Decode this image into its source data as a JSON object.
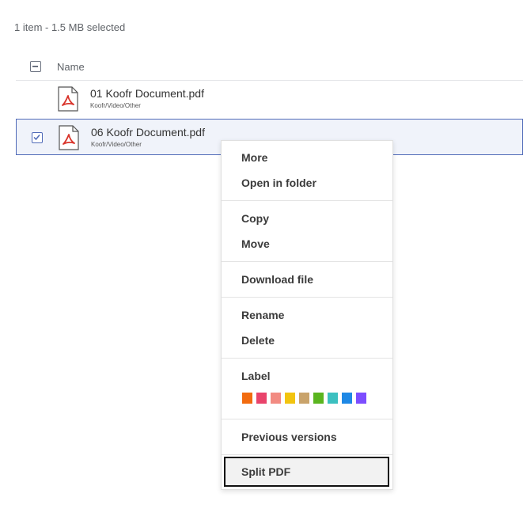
{
  "selection": {
    "summary": "1 item - 1.5 MB selected"
  },
  "list": {
    "header": {
      "name_label": "Name"
    },
    "files": [
      {
        "name": "01 Koofr Document.pdf",
        "path": "Koofr/Video/Other",
        "selected": false,
        "icon": "pdf-file-icon"
      },
      {
        "name": "06 Koofr Document.pdf",
        "path": "Koofr/Video/Other",
        "selected": true,
        "icon": "pdf-file-icon"
      }
    ]
  },
  "context_menu": {
    "more": "More",
    "open_in_folder": "Open in folder",
    "copy": "Copy",
    "move": "Move",
    "download_file": "Download file",
    "rename": "Rename",
    "delete": "Delete",
    "label_title": "Label",
    "label_colors": [
      "#f26b0f",
      "#e9436b",
      "#f28b82",
      "#f2c40f",
      "#c9a36b",
      "#5ab51f",
      "#3cc0c0",
      "#1e88e5",
      "#7c4dff"
    ],
    "previous_versions": "Previous versions",
    "split_pdf": "Split PDF"
  },
  "colors": {
    "selection_border": "#4f6ab8",
    "selection_bg": "#f0f3fa",
    "pdf_red": "#d9342b"
  }
}
